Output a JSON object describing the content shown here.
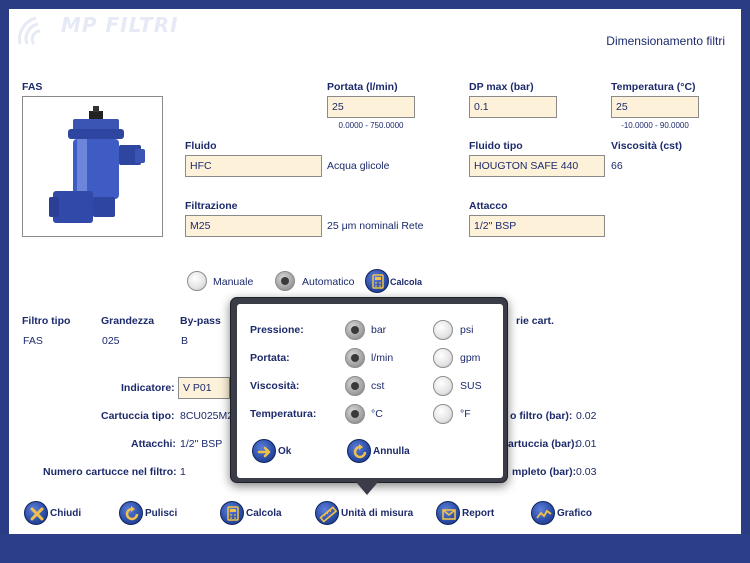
{
  "header": {
    "logo_text": "MP FILTRI",
    "title": "Dimensionamento filtri"
  },
  "product": {
    "name": "FAS"
  },
  "portata": {
    "label": "Portata (l/min)",
    "value": "25",
    "range": "0.0000 - 750.0000"
  },
  "dp_max": {
    "label": "DP max (bar)",
    "value": "0.1"
  },
  "temperatura": {
    "label": "Temperatura (°C)",
    "value": "25",
    "range": "-10.0000 - 90.0000"
  },
  "fluido": {
    "label": "Fluido",
    "value": "HFC",
    "desc": "Acqua glicole"
  },
  "fluido_tipo": {
    "label": "Fluido tipo",
    "value": "HOUGTON SAFE 440"
  },
  "viscosita": {
    "label": "Viscosità (cst)",
    "value": "66"
  },
  "filtrazione": {
    "label": "Filtrazione",
    "value": "M25",
    "desc": "25 μm nominali Rete"
  },
  "attacco": {
    "label": "Attacco",
    "value": "1/2\" BSP"
  },
  "mode": {
    "manuale": "Manuale",
    "automatico": "Automatico",
    "calcola": "Calcola",
    "selected": "Automatico"
  },
  "results": {
    "headers": {
      "filtro_tipo": "Filtro tipo",
      "grandezza": "Grandezza",
      "bypass": "By-pass",
      "serie_cart": "rie cart."
    },
    "values": {
      "filtro_tipo": "FAS",
      "grandezza": "025",
      "bypass": "B"
    },
    "indicatore": {
      "label": "Indicatore:",
      "value": "V P01"
    },
    "cartuccia_tipo": {
      "label": "Cartuccia tipo:",
      "value": "8CU025M2"
    },
    "attacchi": {
      "label": "Attacchi:",
      "value": "1/2\" BSP"
    },
    "numero_cartucce": {
      "label": "Numero cartucce nel filtro:",
      "value": "1"
    },
    "right": [
      {
        "label": "o filtro (bar):",
        "value": "0.02"
      },
      {
        "label": "artuccia (bar):",
        "value": "0.01"
      },
      {
        "label": "mpleto (bar):",
        "value": "0.03"
      }
    ]
  },
  "units_popup": {
    "rows": [
      {
        "label": "Pressione:",
        "opt1": "bar",
        "opt2": "psi",
        "selected": 1
      },
      {
        "label": "Portata:",
        "opt1": "l/min",
        "opt2": "gpm",
        "selected": 1
      },
      {
        "label": "Viscosità:",
        "opt1": "cst",
        "opt2": "SUS",
        "selected": 1
      },
      {
        "label": "Temperatura:",
        "opt1": "°C",
        "opt2": "°F",
        "selected": 1
      }
    ],
    "ok": "Ok",
    "annulla": "Annulla"
  },
  "toolbar": {
    "chiudi": "Chiudi",
    "pulisci": "Pulisci",
    "calcola": "Calcola",
    "unita": "Unità di misura",
    "report": "Report",
    "grafico": "Grafico"
  },
  "colors": {
    "frame": "#2a3d84",
    "field_bg": "#fdf1d9",
    "text": "#1c2a6b",
    "button": "#2d4fa8",
    "popup": "#3a3d48"
  }
}
